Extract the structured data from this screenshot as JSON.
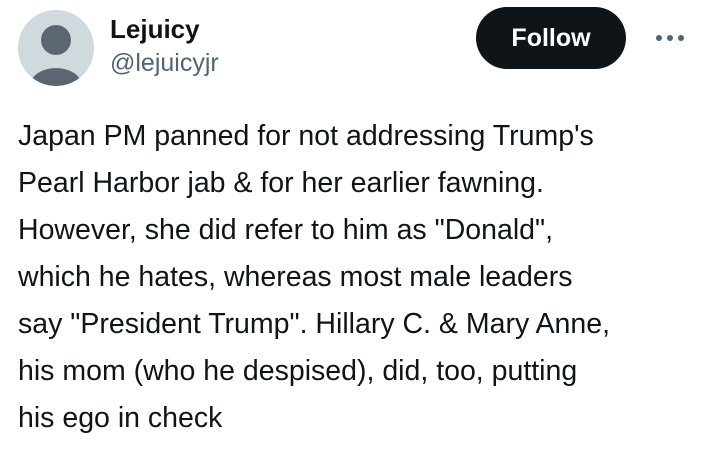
{
  "author": {
    "display_name": "Lejuicy",
    "handle": "@lejuicyjr",
    "avatar_icon": "default-avatar-icon"
  },
  "actions": {
    "follow_label": "Follow",
    "more_icon": "more-horizontal-icon"
  },
  "tweet": {
    "text": "Japan PM panned for not addressing Trump's\nPearl Harbor jab & for her earlier fawning.\nHowever, she did refer to him as \"Donald\",\nwhich he hates, whereas most male leaders\nsay \"President Trump\". Hillary C. & Mary Anne,\nhis mom (who he despised), did, too, putting\nhis ego in check"
  },
  "colors": {
    "text": "#0f1419",
    "secondary_text": "#536471",
    "follow_bg": "#0f1419",
    "avatar_bg": "#cfd9de",
    "avatar_fg": "#5b6670"
  }
}
